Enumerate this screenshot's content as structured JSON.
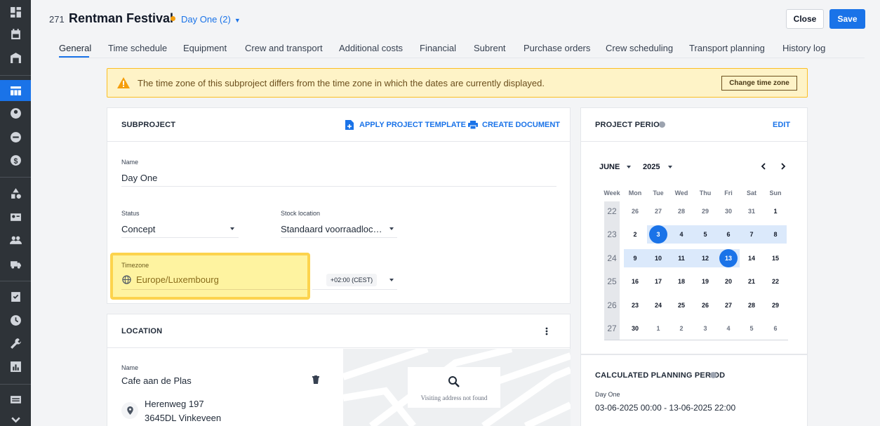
{
  "project": {
    "number": "271",
    "title": "Rentman Festival",
    "subproject_selector": "Day One (2)"
  },
  "actions": {
    "close_label": "Close",
    "save_label": "Save"
  },
  "tabs": [
    "General",
    "Time schedule",
    "Equipment",
    "Crew and transport",
    "Additional costs",
    "Financial",
    "Subrent",
    "Purchase orders",
    "Crew scheduling",
    "Transport planning",
    "History log"
  ],
  "alert": {
    "text": "The time zone of this subproject differs from the time zone in which the dates are currently displayed.",
    "button": "Change time zone"
  },
  "subproject": {
    "title": "SUBPROJECT",
    "apply_template": "APPLY PROJECT TEMPLATE",
    "create_document": "CREATE DOCUMENT",
    "name_label": "Name",
    "name_value": "Day One",
    "status_label": "Status",
    "status_value": "Concept",
    "stock_label": "Stock location",
    "stock_value": "Standaard voorraadloc…",
    "timezone_label": "Timezone",
    "timezone_value": "Europe/Luxembourg",
    "timezone_offset": "+02:00 (CEST)"
  },
  "location": {
    "title": "LOCATION",
    "name_label": "Name",
    "name_value": "Cafe aan de Plas",
    "address_line1": "Herenweg 197",
    "address_line2": "3645DL Vinkeveen",
    "map_message": "Visiting address not found"
  },
  "project_period": {
    "title": "PROJECT PERIOD",
    "edit": "EDIT",
    "month": "JUNE",
    "year": "2025",
    "headers": [
      "Week",
      "Mon",
      "Tue",
      "Wed",
      "Thu",
      "Fri",
      "Sat",
      "Sun"
    ],
    "weeks": [
      {
        "week": "22",
        "days": [
          "26",
          "27",
          "28",
          "29",
          "30",
          "31",
          "1"
        ]
      },
      {
        "week": "23",
        "days": [
          "2",
          "3",
          "4",
          "5",
          "6",
          "7",
          "8"
        ]
      },
      {
        "week": "24",
        "days": [
          "9",
          "10",
          "11",
          "12",
          "13",
          "14",
          "15"
        ]
      },
      {
        "week": "25",
        "days": [
          "16",
          "17",
          "18",
          "19",
          "20",
          "21",
          "22"
        ]
      },
      {
        "week": "26",
        "days": [
          "23",
          "24",
          "25",
          "26",
          "27",
          "28",
          "29"
        ]
      },
      {
        "week": "27",
        "days": [
          "30",
          "1",
          "2",
          "3",
          "4",
          "5",
          "6"
        ]
      }
    ],
    "range_start": "3",
    "range_end": "13"
  },
  "planning_period": {
    "title": "CALCULATED PLANNING PERIOD",
    "label": "Day One",
    "value": "03-06-2025 00:00 - 13-06-2025 22:00"
  },
  "colors": {
    "accent": "#1a73e8",
    "alert_bg": "#fef3c7",
    "highlight": "#fcd34d",
    "sidebar": "#2e3338"
  }
}
